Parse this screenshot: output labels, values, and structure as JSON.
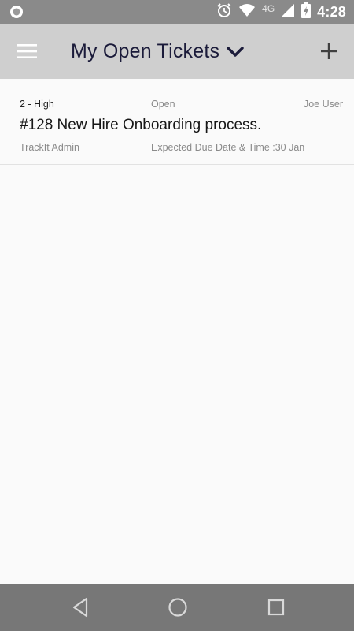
{
  "status_bar": {
    "time": "4:28",
    "network_type": "4G",
    "icons": [
      "circle-notification-icon",
      "alarm-icon",
      "wifi-icon",
      "cellular-signal-icon",
      "battery-charging-icon"
    ]
  },
  "app_bar": {
    "title": "My Open Tickets",
    "menu_icon": "hamburger-menu-icon",
    "dropdown_icon": "chevron-down-icon",
    "add_icon": "plus-icon"
  },
  "tickets": [
    {
      "priority": "2 - High",
      "status": "Open",
      "assignee": "Joe User",
      "title": "#128 New Hire Onboarding process.",
      "creator": "TrackIt Admin",
      "due": "Expected Due Date & Time :30 Jan"
    }
  ],
  "nav_bar": {
    "icons": [
      "back-icon",
      "home-icon",
      "recents-icon"
    ]
  },
  "colors": {
    "status_bar": "#8a8a8a",
    "app_bar": "#cfcfcf",
    "title_text": "#1b1b3a",
    "nav_bar": "#777777",
    "background": "#fafafa"
  }
}
